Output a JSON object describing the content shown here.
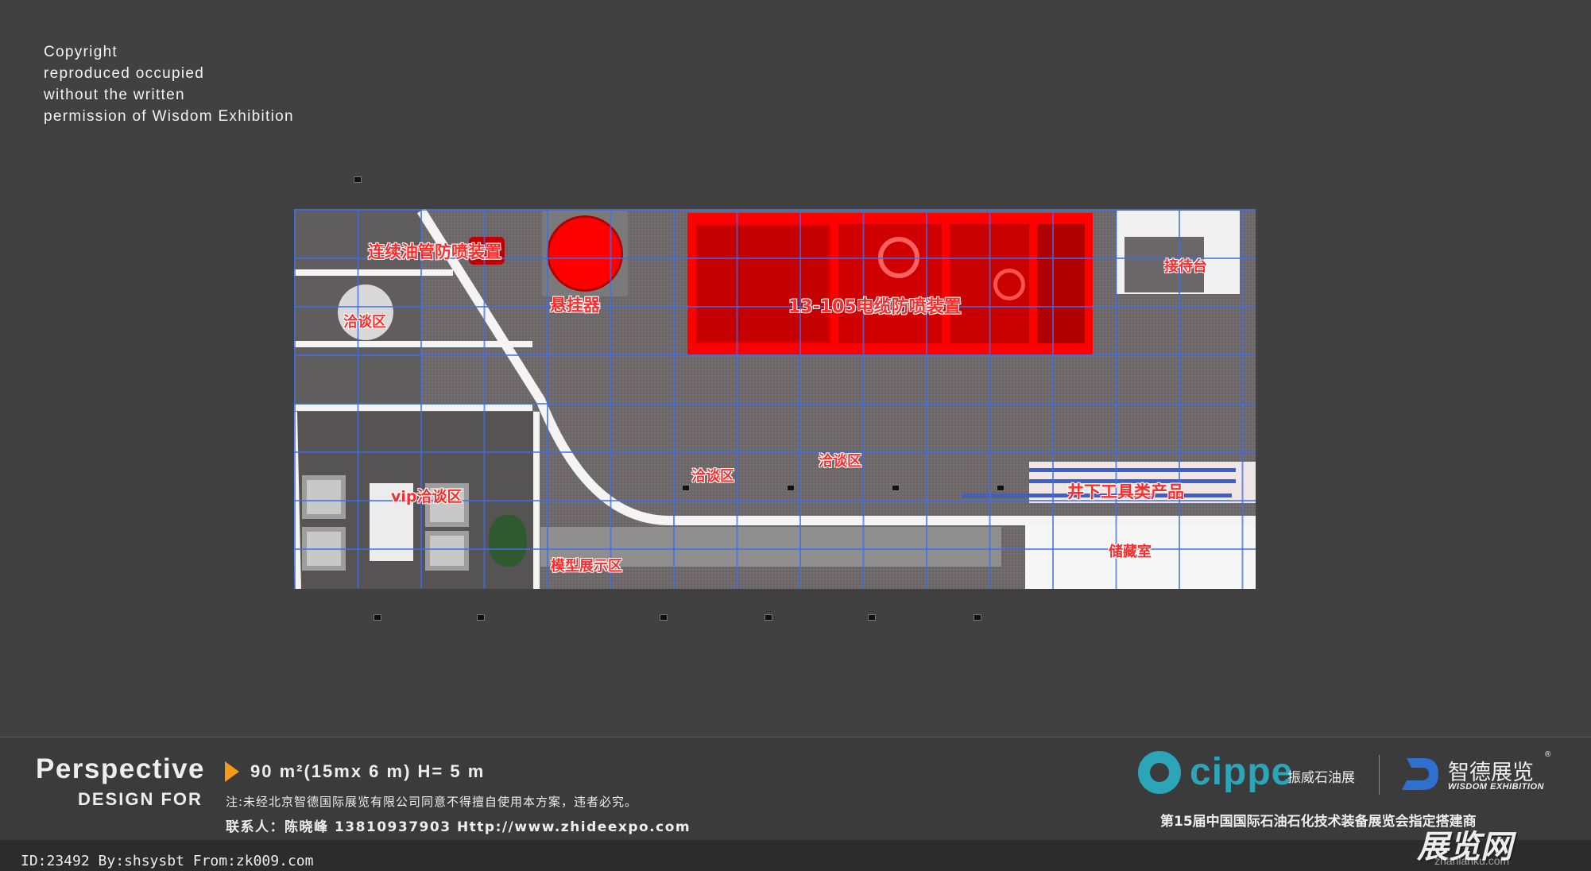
{
  "copyright": {
    "lines": [
      "Copyright",
      "reproduced occupied",
      "without the written",
      "permission of Wisdom Exhibition"
    ]
  },
  "plan": {
    "labels": {
      "coiled_tubing": "连续油管防喷装置",
      "hanger": "悬挂器",
      "negotiation_left": "洽谈区",
      "cable_bop": "13-105电缆防喷装置",
      "reception": "接待台",
      "negotiation_center": "洽谈区",
      "negotiation_right": "洽谈区",
      "vip": "vip洽谈区",
      "downhole": "井下工具类产品",
      "model": "模型展示区",
      "storage": "储藏室"
    },
    "colors": {
      "equipment": "#ff0000",
      "grid": "#3c6eeb",
      "walls": "#f4f4f4",
      "carpet": "#6b6668"
    }
  },
  "banner": {
    "perspective": "Perspective",
    "design_for": "DESIGN FOR",
    "spec": "90 m²(15mx 6 m)   H= 5 m",
    "note": "注:未经北京智德国际展览有限公司同意不得擅自使用本方案，违者必究。",
    "contact": "联系人：陈晓峰 13810937903   Http://www.zhideexpo.com",
    "cippe_word": "cippe",
    "cippe_cn": "振威石油展",
    "zd_cn": "智德展览",
    "zd_reg": "®",
    "zd_en": "WISDOM EXHIBITION",
    "expo_line": "第15届中国国际石油石化技术装备展览会指定搭建商",
    "accent": "#f39a1e",
    "cippe_color": "#2aa6b8"
  },
  "footer": {
    "id_line": "ID:23492 By:shsysbt From:zk009.com",
    "watermark": "展览网",
    "watermark_url": "zhanlanku.com"
  }
}
